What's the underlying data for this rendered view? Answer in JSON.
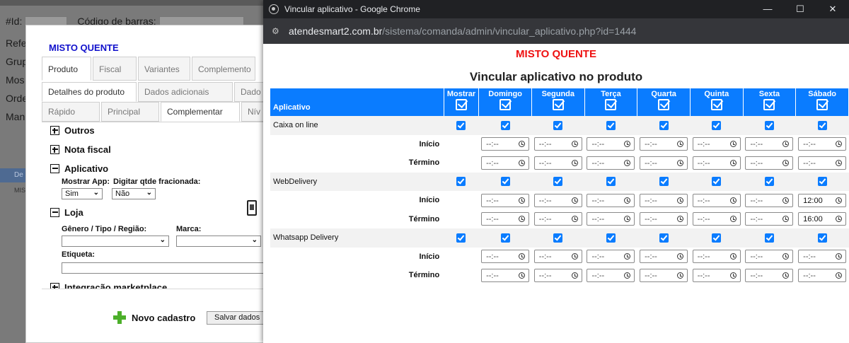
{
  "background_app": {
    "field_id_label": "#Id:",
    "field_barcode_label": "Código de barras:",
    "left_labels": [
      "Refe",
      "Grup",
      "Mos",
      "Orde",
      "Man"
    ],
    "strip_text": "De",
    "mis_text": "MIS"
  },
  "modal": {
    "title": "MISTO QUENTE",
    "tabs_row1": [
      "Produto",
      "Fiscal",
      "Variantes",
      "Complemento"
    ],
    "tabs_row2": [
      "Detalhes do produto",
      "Dados adicionais",
      "Dado"
    ],
    "tabs_row3": [
      "Rápido",
      "Principal",
      "Complementar",
      "Nív"
    ],
    "sections": {
      "outros": "Outros",
      "nota_fiscal": "Nota fiscal",
      "aplicativo": "Aplicativo",
      "loja": "Loja",
      "integracao": "Integração marketplace"
    },
    "mostrar_app_label": "Mostrar App:",
    "mostrar_app_value": "Sim",
    "qtde_label": "Digitar qtde fracionada:",
    "qtde_value": "Não",
    "genero_label": "Gênero / Tipo / Região:",
    "marca_label": "Marca:",
    "etiqueta_label": "Etiqueta:",
    "novo_cadastro": "Novo cadastro",
    "salvar_dados": "Salvar dados"
  },
  "chrome": {
    "window_title": "Vincular aplicativo - Google Chrome",
    "url_host": "atendesmart2.com.br",
    "url_path": "/sistema/comanda/admin/vincular_aplicativo.php?id=1444",
    "controls": {
      "minimize": "—",
      "maximize": "☐",
      "close": "✕"
    }
  },
  "page": {
    "title": "MISTO QUENTE",
    "subtitle": "Vincular aplicativo no produto",
    "columns": [
      "Aplicativo",
      "Mostrar",
      "Domingo",
      "Segunda",
      "Terça",
      "Quarta",
      "Quinta",
      "Sexta",
      "Sábado"
    ],
    "start_label": "Início",
    "end_label": "Término",
    "time_placeholder": "--:--",
    "apps": [
      {
        "name": "Caixa on line",
        "inicio_sabado": "--:--",
        "termino_sabado": "--:--"
      },
      {
        "name": "WebDelivery",
        "inicio_sabado": "12:00",
        "termino_sabado": "16:00"
      },
      {
        "name": "Whatsapp Delivery",
        "inicio_sabado": "--:--",
        "termino_sabado": "--:--"
      }
    ]
  },
  "colors": {
    "accent": "#0a7cff",
    "title_red": "#ee1111",
    "modal_title_blue": "#1111cc",
    "chrome_dark": "#202124"
  }
}
